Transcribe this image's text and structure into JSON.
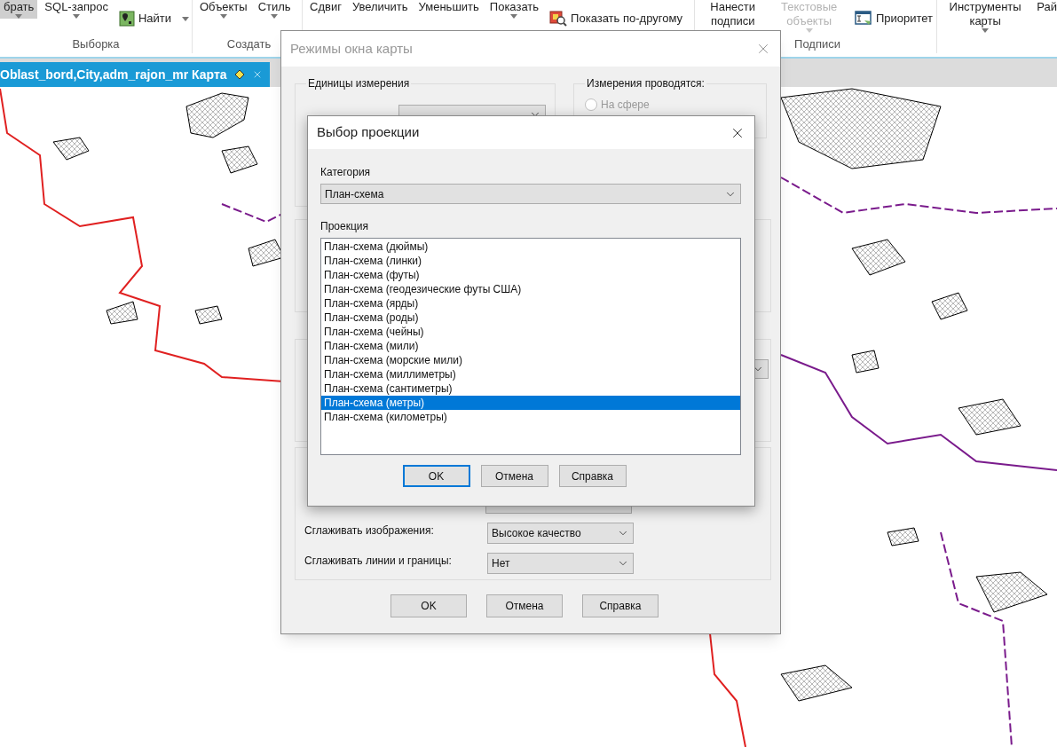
{
  "ribbon": {
    "groups": [
      {
        "label": "Выборка",
        "items": [
          {
            "label": "брать",
            "kind": "large",
            "caret": true,
            "selected": true
          },
          {
            "label": "SQL-запрос",
            "kind": "large",
            "caret": true,
            "selected": false
          },
          {
            "label": "Найти",
            "kind": "icon",
            "caret": true,
            "selected": false
          }
        ]
      },
      {
        "label": "Создать",
        "items": [
          {
            "label": "Объекты",
            "kind": "large",
            "caret": true,
            "selected": false
          },
          {
            "label": "Стиль",
            "kind": "large",
            "caret": true,
            "selected": false
          }
        ]
      },
      {
        "items": [
          {
            "label": "Сдвиг",
            "kind": "large",
            "caret": false,
            "selected": false
          },
          {
            "label": "Увеличить",
            "kind": "large",
            "caret": false,
            "selected": false
          },
          {
            "label": "Уменьшить",
            "kind": "large",
            "caret": false,
            "selected": false
          },
          {
            "label": "Показать",
            "kind": "large",
            "caret": true,
            "selected": false
          },
          {
            "label": "Показать по-другому",
            "kind": "icon",
            "caret": false,
            "selected": false
          }
        ]
      },
      {
        "label": "Подписи",
        "items": [
          {
            "label": "Нанести подписи",
            "kind": "large",
            "caret": false,
            "selected": false
          },
          {
            "label": "Текстовые объекты",
            "kind": "large",
            "caret": true,
            "selected": false,
            "disabled": true
          },
          {
            "label": "Приоритет",
            "kind": "icon",
            "caret": false,
            "selected": false
          }
        ]
      },
      {
        "items": [
          {
            "label": "Инструменты карты",
            "kind": "large",
            "caret": true,
            "selected": false
          },
          {
            "label": "Рай",
            "kind": "large",
            "caret": false,
            "selected": false
          }
        ]
      }
    ]
  },
  "map_tab": {
    "title": "Oblast_bord,City,adm_rajon_mr Карта"
  },
  "map_options_dialog": {
    "title": "Режимы окна карты",
    "units_group": {
      "title": "Единицы измерения"
    },
    "measure_group": {
      "title": "Измерения проводятся:",
      "options": [
        {
          "label": "На сфере",
          "selected": false,
          "disabled": true
        }
      ]
    },
    "smoothing_fields": [
      {
        "label": "Сглаживать изображения:",
        "value": "Высокое качество"
      },
      {
        "label": "Сглаживать линии и границы:",
        "value": "Нет"
      }
    ],
    "buttons": [
      "OK",
      "Отмена",
      "Справка"
    ]
  },
  "projection_dialog": {
    "title": "Выбор проекции",
    "category_label": "Категория",
    "category_value": "План-схема",
    "projection_label": "Проекция",
    "projections": [
      {
        "label": "План-схема (дюймы)",
        "selected": false
      },
      {
        "label": "План-схема (линки)",
        "selected": false
      },
      {
        "label": "План-схема (футы)",
        "selected": false
      },
      {
        "label": "План-схема (геодезические футы США)",
        "selected": false
      },
      {
        "label": "План-схема (ярды)",
        "selected": false
      },
      {
        "label": "План-схема (роды)",
        "selected": false
      },
      {
        "label": "План-схема (чейны)",
        "selected": false
      },
      {
        "label": "План-схема (мили)",
        "selected": false
      },
      {
        "label": "План-схема (морские мили)",
        "selected": false
      },
      {
        "label": "План-схема (миллиметры)",
        "selected": false
      },
      {
        "label": "План-схема (сантиметры)",
        "selected": false
      },
      {
        "label": "План-схема (метры)",
        "selected": true
      },
      {
        "label": "План-схема (километры)",
        "selected": false
      }
    ],
    "buttons": [
      {
        "label": "OK",
        "default": true
      },
      {
        "label": "Отмена",
        "default": false
      },
      {
        "label": "Справка",
        "default": false
      }
    ]
  }
}
